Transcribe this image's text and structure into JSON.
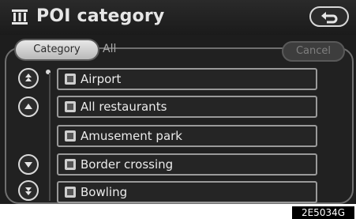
{
  "header": {
    "title": "POI category",
    "icon": "building-icon",
    "back_icon": "return-arrow-icon"
  },
  "tabs": [
    {
      "label": "Category",
      "active": true
    },
    {
      "label": "All",
      "active": false
    }
  ],
  "cancel_label": "Cancel",
  "scroll_buttons": [
    "page-up-icon",
    "up-icon",
    "down-icon",
    "page-down-icon"
  ],
  "items": [
    {
      "label": "Airport",
      "icon": "airport-icon"
    },
    {
      "label": "All restaurants",
      "icon": "restaurant-icon"
    },
    {
      "label": "Amusement park",
      "icon": "amusement-park-icon"
    },
    {
      "label": "Border crossing",
      "icon": "border-crossing-icon"
    },
    {
      "label": "Bowling",
      "icon": "bowling-icon"
    }
  ],
  "caption": "2E5034G"
}
